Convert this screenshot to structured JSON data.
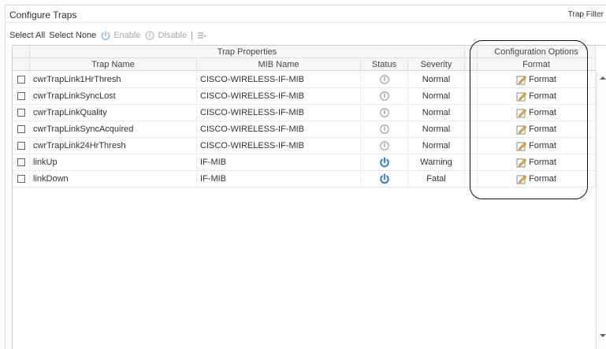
{
  "panel": {
    "title": "Configure Traps",
    "trap_filter": "Trap Filter"
  },
  "toolbar": {
    "select_all": "Select All",
    "select_none": "Select None",
    "enable": "Enable",
    "disable": "Disable",
    "separator": "|"
  },
  "table": {
    "group_headers": {
      "trap_properties": "Trap Properties",
      "configuration_options": "Configuration Options"
    },
    "columns": {
      "trap_name": "Trap Name",
      "mib_name": "MIB Name",
      "status": "Status",
      "severity": "Severity",
      "format": "Format"
    },
    "rows": [
      {
        "trap_name": "cwrTrapLink1HrThresh",
        "mib_name": "CISCO-WIRELESS-IF-MIB",
        "status": "disabled",
        "severity": "Normal",
        "format": "Format"
      },
      {
        "trap_name": "cwrTrapLinkSyncLost",
        "mib_name": "CISCO-WIRELESS-IF-MIB",
        "status": "disabled",
        "severity": "Normal",
        "format": "Format"
      },
      {
        "trap_name": "cwrTrapLinkQuality",
        "mib_name": "CISCO-WIRELESS-IF-MIB",
        "status": "disabled",
        "severity": "Normal",
        "format": "Format"
      },
      {
        "trap_name": "cwrTrapLinkSyncAcquired",
        "mib_name": "CISCO-WIRELESS-IF-MIB",
        "status": "disabled",
        "severity": "Normal",
        "format": "Format"
      },
      {
        "trap_name": "cwrTrapLink24HrThresh",
        "mib_name": "CISCO-WIRELESS-IF-MIB",
        "status": "disabled",
        "severity": "Normal",
        "format": "Format"
      },
      {
        "trap_name": "linkUp",
        "mib_name": "IF-MIB",
        "status": "enabled",
        "severity": "Warning",
        "format": "Format"
      },
      {
        "trap_name": "linkDown",
        "mib_name": "IF-MIB",
        "status": "enabled",
        "severity": "Fatal",
        "format": "Format"
      }
    ]
  },
  "colors": {
    "enabled_power": "#1a7fd6",
    "disabled_power": "#9a9a9a",
    "toolbar_enable_icon": "#8cbfe8"
  }
}
